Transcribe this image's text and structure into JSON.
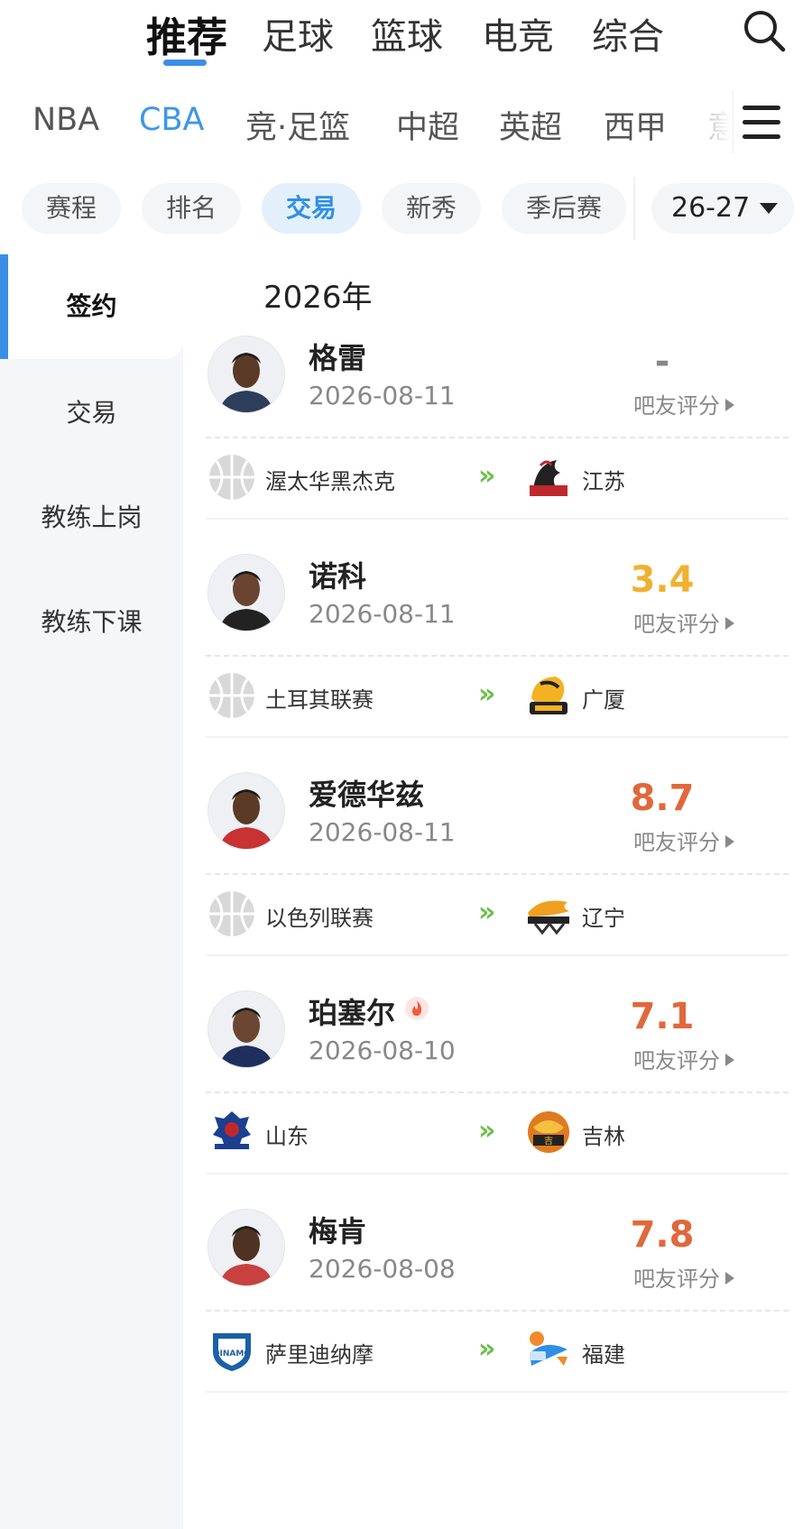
{
  "top_nav": {
    "tabs": [
      "推荐",
      "足球",
      "篮球",
      "电竞",
      "综合"
    ],
    "active": "推荐"
  },
  "league_tabs": {
    "items": [
      "NBA",
      "CBA",
      "竞·足篮",
      "中超",
      "英超",
      "西甲",
      "意"
    ],
    "active": "CBA"
  },
  "filters": {
    "items": [
      "赛程",
      "排名",
      "交易",
      "新秀",
      "季后赛"
    ],
    "active": "交易",
    "season": "26-27"
  },
  "sidebar": {
    "items": [
      "签约",
      "交易",
      "教练上岗",
      "教练下课"
    ],
    "active": "签约"
  },
  "section_year": "2026年",
  "rating_label": "吧友评分",
  "accent_color": "#3a8ee6",
  "transactions": [
    {
      "name": "格雷",
      "date": "2026-08-11",
      "score": "-",
      "score_color": "#888888",
      "hot": false,
      "from": "渥太华黑杰克",
      "from_logo": "basketball-placeholder",
      "to": "江苏",
      "to_logo": "jiangsu-dragons-logo"
    },
    {
      "name": "诺科",
      "date": "2026-08-11",
      "score": "3.4",
      "score_color": "#f0b030",
      "hot": false,
      "from": "土耳其联赛",
      "from_logo": "basketball-placeholder",
      "to": "广厦",
      "to_logo": "zhejiang-lions-logo"
    },
    {
      "name": "爱德华兹",
      "date": "2026-08-11",
      "score": "8.7",
      "score_color": "#e0683c",
      "hot": false,
      "from": "以色列联赛",
      "from_logo": "basketball-placeholder",
      "to": "辽宁",
      "to_logo": "liaoning-leopards-logo"
    },
    {
      "name": "珀塞尔",
      "date": "2026-08-10",
      "score": "7.1",
      "score_color": "#e0683c",
      "hot": true,
      "from": "山东",
      "from_logo": "shandong-logo",
      "to": "吉林",
      "to_logo": "jilin-tigers-logo"
    },
    {
      "name": "梅肯",
      "date": "2026-08-08",
      "score": "7.8",
      "score_color": "#e0683c",
      "hot": false,
      "from": "萨里迪纳摩",
      "from_logo": "dinamo-sassari-logo",
      "to": "福建",
      "to_logo": "fujian-sturgeons-logo"
    }
  ]
}
